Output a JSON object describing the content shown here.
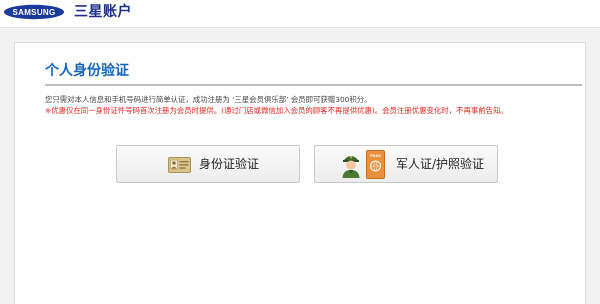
{
  "header": {
    "brand_logo_text": "SAMSUNG",
    "title": "三星账户"
  },
  "main": {
    "title": "个人身份验证",
    "description": "您只需对本人信息和手机号码进行简单认证，成功注册为 ‘三星会员俱乐部’ 会员即可获赠300积分。",
    "notice": "※优惠仅在同一身份证件号码首次注册为会员时提供。(通过门店或微信加入会员的顾客不再提供优惠)。会员注册优惠变化时，不再事前告知。",
    "buttons": [
      {
        "label": "身份证验证",
        "icon": "id-card-icon"
      },
      {
        "label": "军人证/护照验证",
        "icon": "soldier-passport-icon"
      }
    ]
  },
  "colors": {
    "title_blue": "#1565c0",
    "brand_navy": "#1c2f8a",
    "notice_red": "#e3261d"
  }
}
